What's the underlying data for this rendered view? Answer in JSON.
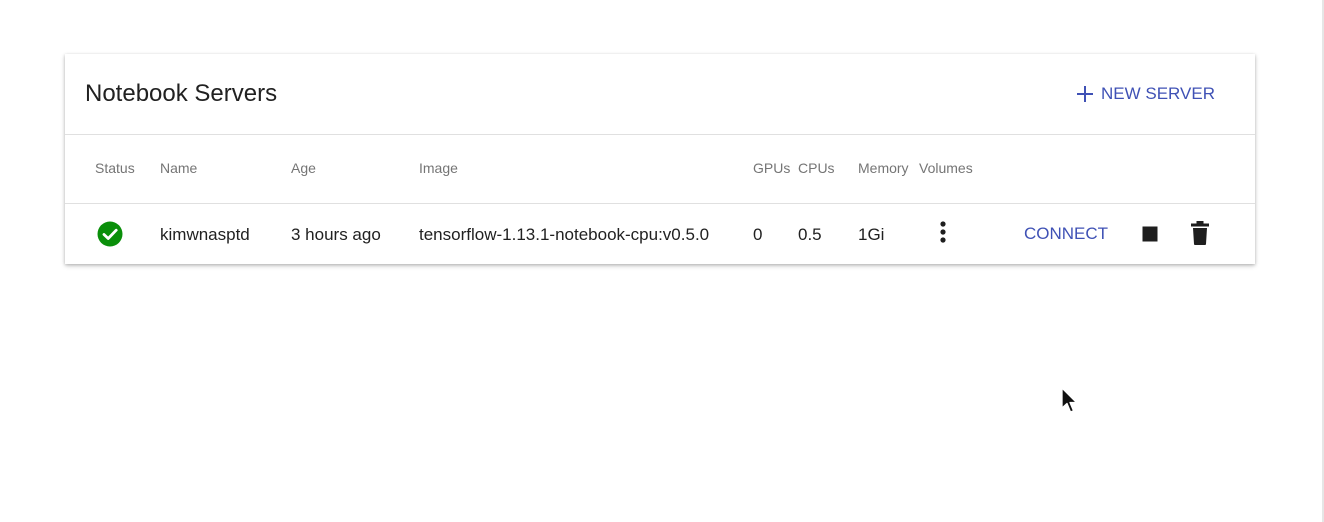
{
  "card": {
    "title": "Notebook Servers",
    "new_server_label": "NEW SERVER"
  },
  "table": {
    "columns": [
      "Status",
      "Name",
      "Age",
      "Image",
      "GPUs",
      "CPUs",
      "Memory",
      "Volumes"
    ],
    "rows": [
      {
        "status": "running",
        "name": "kimwnasptd",
        "age": "3 hours ago",
        "image": "tensorflow-1.13.1-notebook-cpu:v0.5.0",
        "gpus": "0",
        "cpus": "0.5",
        "memory": "1Gi",
        "connect_label": "CONNECT"
      }
    ]
  },
  "colors": {
    "accent": "#3f51b5",
    "status_ok": "#0a8f0a",
    "icon_dark": "#1e1e1e"
  },
  "icons": {
    "new_server": "plus-icon",
    "status": "check-circle-icon",
    "volumes": "more-vert-icon",
    "stop": "stop-icon",
    "delete": "trash-icon"
  }
}
